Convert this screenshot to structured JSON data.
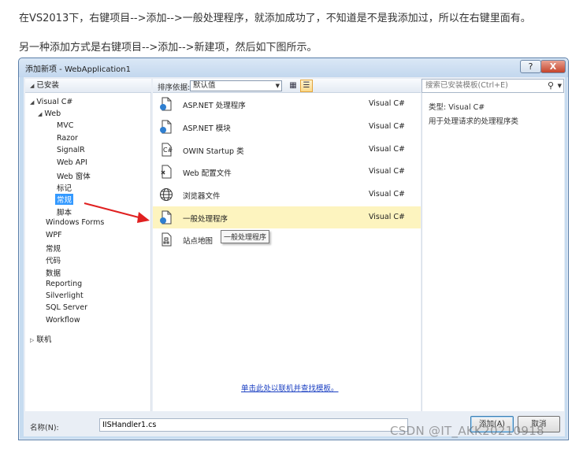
{
  "article": {
    "para1": "在VS2013下，右键项目-->添加-->一般处理程序，就添加成功了，不知道是不是我添加过，所以在右键里面有。",
    "para2": "另一种添加方式是右键项目-->添加-->新建项，然后如下图所示。"
  },
  "dialog": {
    "title": "添加新项 - WebApplication1",
    "help_label": "?",
    "close_label": "X",
    "tree_header": "已安装",
    "tree_header_arrow": "◢",
    "tree": [
      {
        "label": "Visual C#",
        "arrow": "◢"
      },
      {
        "label": "Web",
        "arrow": "◢"
      },
      {
        "label": "MVC"
      },
      {
        "label": "Razor"
      },
      {
        "label": "SignalR"
      },
      {
        "label": "Web API"
      },
      {
        "label": "Web 窗体"
      },
      {
        "label": "标记"
      },
      {
        "label": "常规"
      },
      {
        "label": "脚本"
      },
      {
        "label": "Windows Forms"
      },
      {
        "label": "WPF"
      },
      {
        "label": "常规"
      },
      {
        "label": "代码"
      },
      {
        "label": "数据"
      },
      {
        "label": "Reporting"
      },
      {
        "label": "Silverlight"
      },
      {
        "label": "SQL Server"
      },
      {
        "label": "Workflow"
      },
      {
        "label": "联机",
        "arrow": "▷"
      }
    ],
    "sort_label": "排序依据:",
    "sort_value": "默认值",
    "search_placeholder": "搜索已安装模板(Ctrl+E)",
    "templates": [
      {
        "name": "ASP.NET 处理程序",
        "lang": "Visual C#"
      },
      {
        "name": "ASP.NET 模块",
        "lang": "Visual C#"
      },
      {
        "name": "OWIN Startup 类",
        "lang": "Visual C#"
      },
      {
        "name": "Web 配置文件",
        "lang": "Visual C#"
      },
      {
        "name": "浏览器文件",
        "lang": "Visual C#"
      },
      {
        "name": "一般处理程序",
        "lang": "Visual C#"
      },
      {
        "name": "站点地图",
        "lang": ""
      }
    ],
    "tooltip": "一般处理程序",
    "online_link": "单击此处以联机并查找模板。",
    "info_type": "类型:  Visual C#",
    "info_desc": "用于处理请求的处理程序类",
    "name_label": "名称(N):",
    "name_value": "IISHandler1.cs",
    "add_label": "添加(A)",
    "cancel_label": "取消"
  },
  "watermark": "CSDN @IT_AKK20210918",
  "colors": {
    "selection": "#3399ff",
    "selected_row": "#fdf4bf",
    "annotation_arrow": "#e02020"
  }
}
